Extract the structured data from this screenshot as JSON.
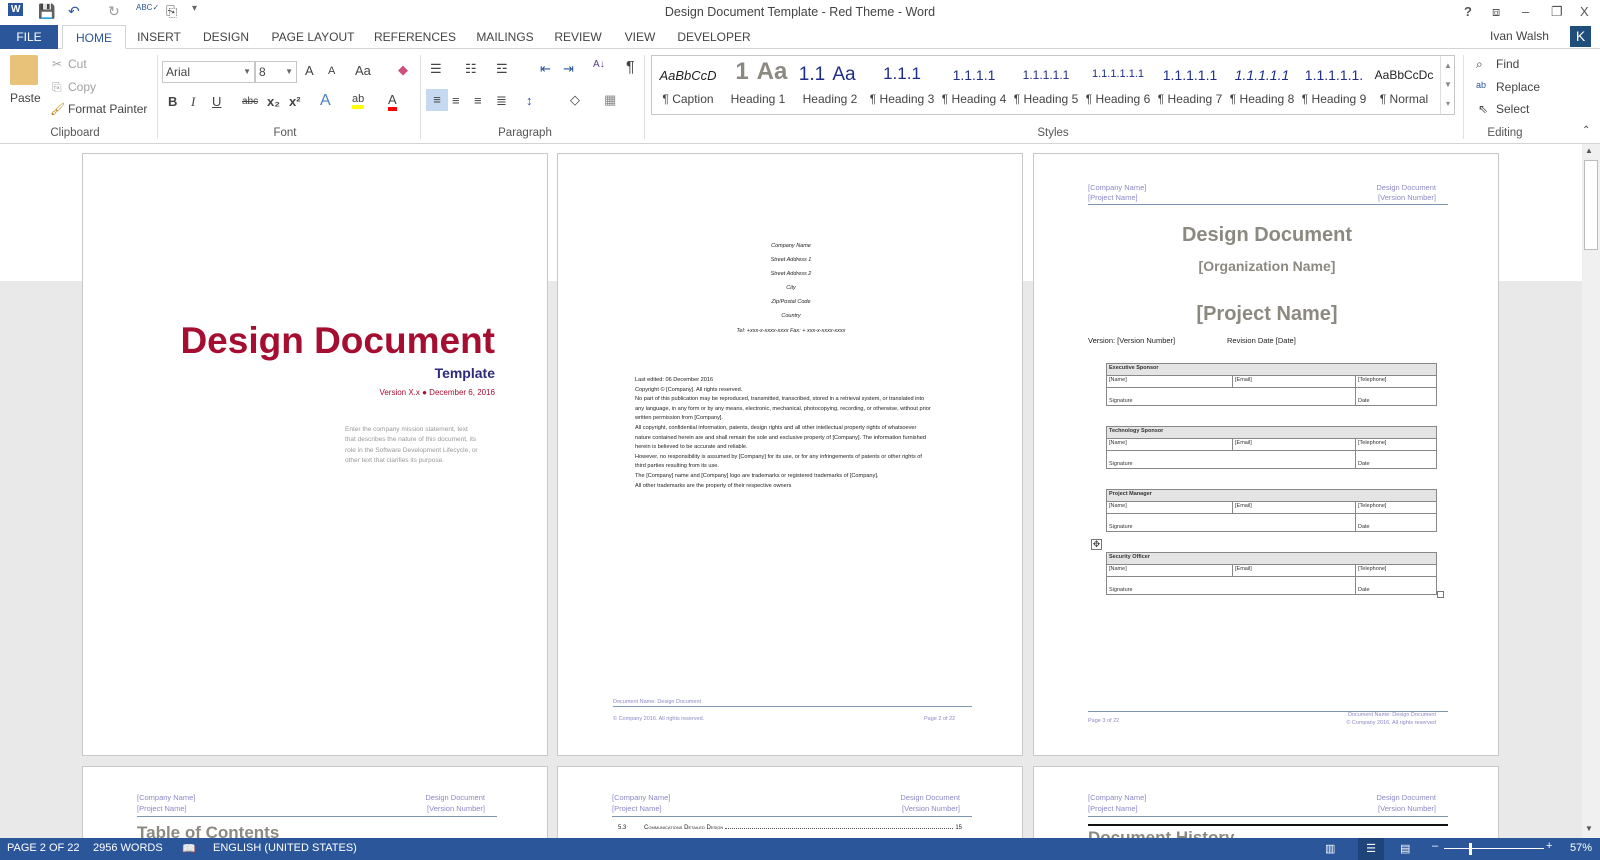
{
  "window": {
    "title": "Design Document Template - Red Theme - Word",
    "user": "Ivan Walsh",
    "avatar_letter": "K",
    "help": "?",
    "ribbon_display": "⧈",
    "minimize": "–",
    "restore": "❐",
    "close": "X"
  },
  "qat": {
    "word": "W",
    "save": "💾",
    "undo": "↶",
    "redo": "↻",
    "spelling": "ABC✓",
    "touch": "⎘",
    "customize": "▾"
  },
  "tabs": [
    "FILE",
    "HOME",
    "INSERT",
    "DESIGN",
    "PAGE LAYOUT",
    "REFERENCES",
    "MAILINGS",
    "REVIEW",
    "VIEW",
    "DEVELOPER"
  ],
  "clipboard": {
    "paste": "Paste",
    "cut": "Cut",
    "copy": "Copy",
    "format_painter": "Format Painter",
    "label": "Clipboard"
  },
  "font": {
    "name": "Arial",
    "size": "8",
    "label": "Font",
    "grow": "A",
    "shrink": "A",
    "case": "Aa",
    "bold": "B",
    "italic": "I",
    "underline": "U",
    "strike": "abc",
    "sub": "x₂",
    "sup": "x²",
    "effects": "A",
    "highlight": "ab",
    "color": "A"
  },
  "paragraph": {
    "label": "Paragraph",
    "sort": "A↓",
    "pilcrow": "¶"
  },
  "styles": {
    "label": "Styles",
    "items": [
      {
        "preview": "AaBbCcD",
        "name": "¶ Caption"
      },
      {
        "preview": "1",
        "name": "Heading 1"
      },
      {
        "preview": "Aa",
        "name": "Heading 2"
      },
      {
        "preview": "1.1",
        "name": "Heading 2"
      },
      {
        "preview": "Aa",
        "name": "¶ Heading 3"
      },
      {
        "preview": "1.1.1",
        "name": "¶ Heading 4"
      },
      {
        "preview": "1.1.1.1",
        "name": "¶ Heading 5"
      },
      {
        "preview": "1.1.1.1.1",
        "name": "¶ Heading 6"
      },
      {
        "preview": "1.1.1.1.1.1",
        "name": "¶ Heading 7"
      },
      {
        "preview": "1.1.1.1.1",
        "name": "¶ Heading 8"
      },
      {
        "preview": "1.1.1.1.1",
        "name": "¶ Heading 9"
      },
      {
        "preview": "1.1.1.1.1.",
        "name": "¶ Normal"
      },
      {
        "preview": "AaBbCcDc",
        "name": ""
      }
    ]
  },
  "editing": {
    "find": "Find",
    "replace": "Replace",
    "select": "Select",
    "label": "Editing"
  },
  "page1": {
    "title": "Design Document",
    "subtitle": "Template",
    "version": "Version X.x ● December 6, 2016",
    "mission": "Enter the company mission statement, text that describes the nature of this document, its role in the Software Development Lifecycle, or other text that clarifies its purpose."
  },
  "page2": {
    "address": [
      "Company Name",
      "Street Address 1",
      "Street Address 2",
      "City",
      "Zip/Postal Code",
      "Country",
      "Tel: +xxx-x-xxxx-xxxx Fax: + xxx-x-xxxx-xxxx"
    ],
    "body": [
      "Last edited: 06 December 2016",
      "Copyright © [Company].  All rights reserved.",
      "No part of this publication may be reproduced, transmitted, transcribed, stored in a retrieval system, or translated into any language, in any form or by any means, electronic, mechanical, photocopying, recording, or otherwise, without prior written permission from [Company].",
      "All copyright, confidential information, patents, design rights and all other intellectual property rights of whatsoever nature contained herein are and shall remain the sole and exclusive property of [Company]. The information furnished herein is believed to be accurate and reliable.",
      "However, no responsibility is assumed by [Company] for its use, or for any infringements of patents or other rights of third parties resulting from its use.",
      "The [Company] name and [Company] logo are trademarks or registered trademarks of [Company].",
      "All other trademarks are the property of their respective owners"
    ],
    "footer_name": "Document Name: Design Document",
    "footer_copy": "© Company 2016. All rights reserved.",
    "footer_page": "Page 2 of 22"
  },
  "header": {
    "company": "[Company Name]",
    "project": "[Project Name]",
    "doc": "Design Document",
    "version": "[Version Number]"
  },
  "page3": {
    "title": "Design Document",
    "org": "[Organization Name]",
    "project": "[Project Name]",
    "version": "Version: [Version Number]",
    "revision": "Revision Date [Date]",
    "tables": [
      "Executive Sponsor",
      "Technology Sponsor",
      "Project Manager",
      "Security Officer"
    ],
    "cells": {
      "name": "[Name]",
      "email": "[Email]",
      "phone": "[Telephone]",
      "signature": "Signature",
      "date": "Date"
    },
    "footer_page": "Page 3 of 22",
    "footer_name": "Document Name: Design Document",
    "footer_copy": "© Company 2016. All rights reserved"
  },
  "page4": {
    "heading": "Table of Contents"
  },
  "page5": {
    "toc_num": "5.3",
    "toc_text": "Communications Detailed Design",
    "toc_page": "15"
  },
  "page6": {
    "heading": "Document History"
  },
  "status": {
    "page": "PAGE 2 OF 22",
    "words": "2956 WORDS",
    "language": "ENGLISH (UNITED STATES)",
    "zoom": "57%",
    "zoom_percent": 57
  }
}
